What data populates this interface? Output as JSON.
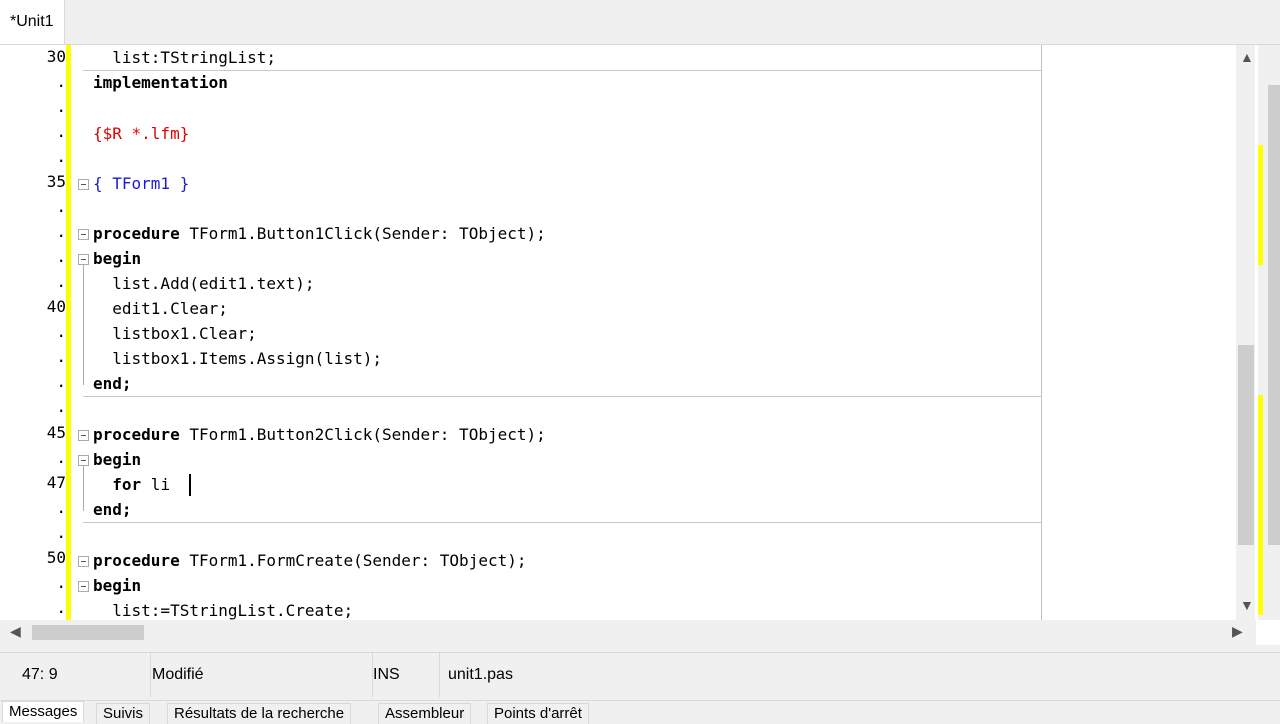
{
  "tab": {
    "title": "*Unit1"
  },
  "gutter": {
    "line_markers": [
      "30",
      ".",
      ".",
      ".",
      ".",
      "35",
      ".",
      ".",
      ".",
      ".",
      "40",
      ".",
      ".",
      ".",
      ".",
      "45",
      ".",
      "47",
      ".",
      ".",
      "50",
      ".",
      "."
    ]
  },
  "code": {
    "l30": "  list:TStringList;",
    "l31": "implementation",
    "l33": "{$R *.lfm}",
    "l35": "{ TForm1 }",
    "l37_kw": "procedure",
    "l37_rest": " TForm1.Button1Click(Sender: TObject);",
    "l38": "begin",
    "l39": "  list.Add(edit1.text);",
    "l40": "  edit1.Clear;",
    "l41": "  listbox1.Clear;",
    "l42": "  listbox1.Items.Assign(list);",
    "l43": "end;",
    "l45_kw": "procedure",
    "l45_rest": " TForm1.Button2Click(Sender: TObject);",
    "l46": "begin",
    "l47_kw": "for",
    "l47_rest": " li",
    "l48": "end;",
    "l50_kw": "procedure",
    "l50_rest": " TForm1.FormCreate(Sender: TObject);",
    "l51": "begin",
    "l52": "  list:=TStringList.Create;"
  },
  "status": {
    "position": "47: 9",
    "modified": "Modifié",
    "mode": "INS",
    "file": "unit1.pas"
  },
  "bottom_tabs": [
    "Messages",
    "Suivis",
    "Résultats de la recherche",
    "Assembleur",
    "Points d'arrêt"
  ],
  "colors": {
    "modified_bar": "#ffff00",
    "saved_bar": "#00cc00",
    "symbol": "#d40000",
    "comment": "#1a1acc"
  }
}
